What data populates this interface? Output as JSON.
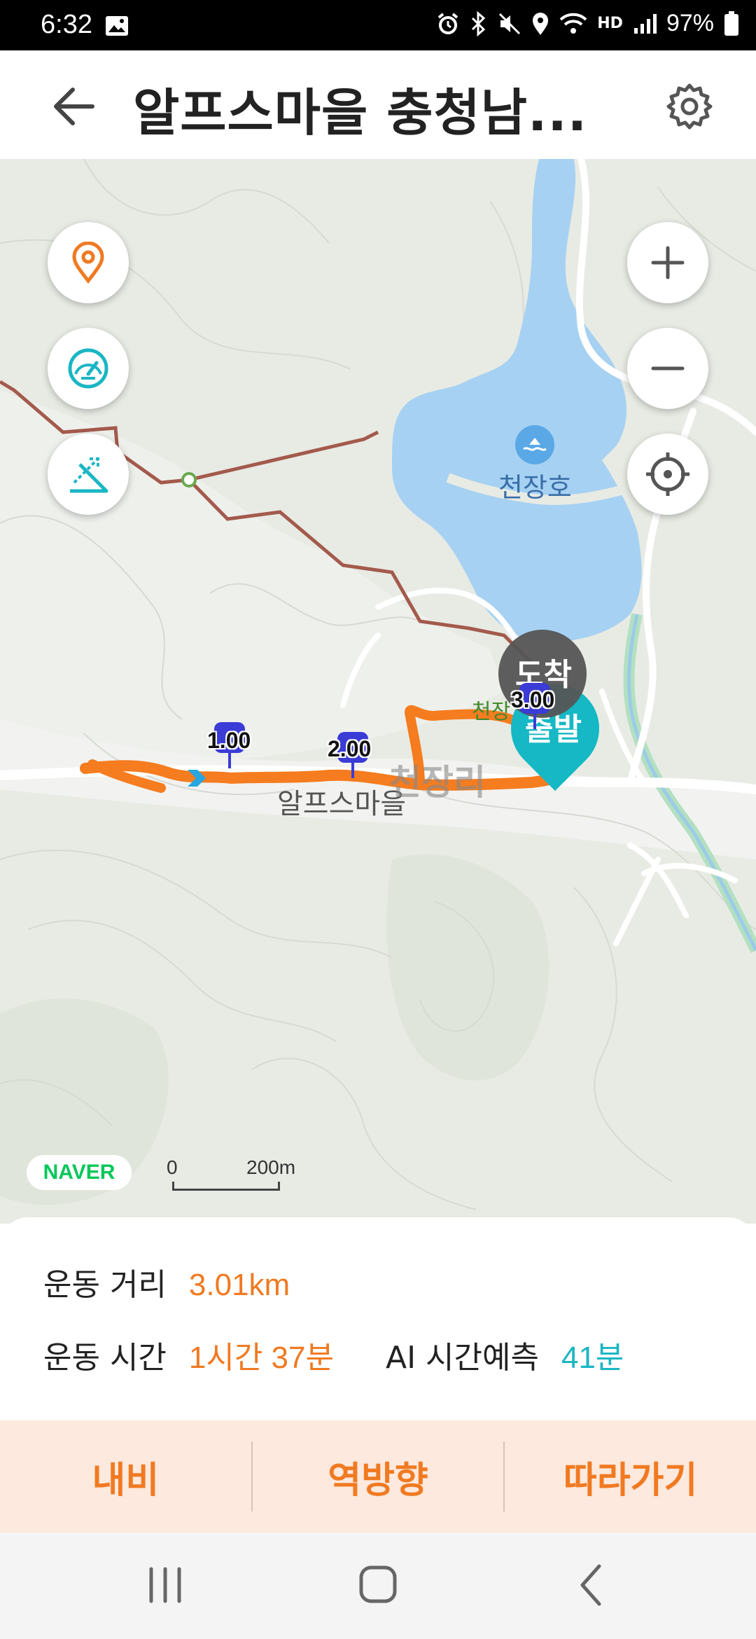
{
  "status": {
    "time": "6:32",
    "battery": "97%",
    "hd_label": "HD"
  },
  "header": {
    "title": "알프스마을 충청남...",
    "back_icon": "back-arrow-icon",
    "settings_icon": "gear-icon"
  },
  "map": {
    "lake_label": "천장호",
    "village_label": "알프스마을",
    "area_label": "천장리",
    "place_label": "천장",
    "arrival_label": "도착",
    "start_label": "출발",
    "km_markers": [
      "1.00",
      "2.00",
      "3.00"
    ],
    "provider": "NAVER",
    "scale_start": "0",
    "scale_end": "200m",
    "controls": {
      "location_pin_icon": "location-pin-icon",
      "speedometer_icon": "speedometer-icon",
      "elevation_icon": "elevation-icon",
      "zoom_in_icon": "plus-icon",
      "zoom_out_icon": "minus-icon",
      "my_location_icon": "crosshair-icon"
    },
    "colors": {
      "route": "#f57c1f",
      "lake": "#a6d1f2",
      "marker": "#3b3bd6",
      "start": "#1ab6c4",
      "trail": "#a35a4c"
    }
  },
  "info": {
    "distance_label": "운동 거리",
    "distance_value": "3.01km",
    "time_label": "운동 시간",
    "time_value": "1시간 37분",
    "ai_label": "AI 시간예측",
    "ai_value": "41분"
  },
  "actions": {
    "navi": "내비",
    "reverse": "역방향",
    "follow": "따라가기"
  }
}
